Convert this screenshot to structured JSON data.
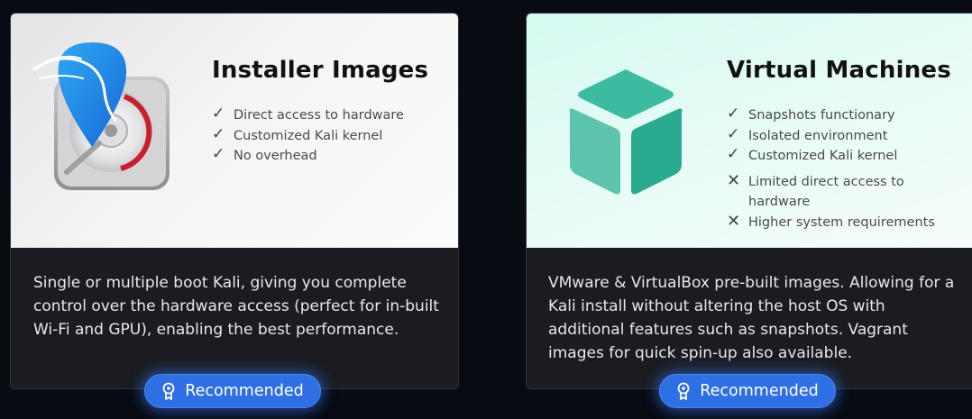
{
  "cards": [
    {
      "title": "Installer Images",
      "features": [
        {
          "mark": "check",
          "text": "Direct access to hardware"
        },
        {
          "mark": "check",
          "text": "Customized Kali kernel"
        },
        {
          "mark": "check",
          "text": "No overhead"
        }
      ],
      "description": "Single or multiple boot Kali, giving you complete control over the hardware access (perfect for in-built Wi-Fi and GPU), enabling the best performance.",
      "badge": "Recommended",
      "icon": "kali-disk-icon"
    },
    {
      "title": "Virtual Machines",
      "features": [
        {
          "mark": "check",
          "text": "Snapshots functionary"
        },
        {
          "mark": "check",
          "text": "Isolated environment"
        },
        {
          "mark": "check",
          "text": "Customized Kali kernel"
        },
        {
          "mark": "cross",
          "text": "Limited direct access to hardware"
        },
        {
          "mark": "cross",
          "text": "Higher system requirements"
        }
      ],
      "description": "VMware & VirtualBox pre-built images. Allowing for a Kali install without altering the host OS with additional features such as snapshots. Vagrant images for quick spin-up also available.",
      "badge": "Recommended",
      "icon": "cube-icon"
    }
  ],
  "colors": {
    "background": "#080b12",
    "card_body": "#1b1c21",
    "badge": "#2e6fe4",
    "cube": "#3dbba0"
  },
  "icons": {
    "check": "✓",
    "cross": "✕"
  }
}
